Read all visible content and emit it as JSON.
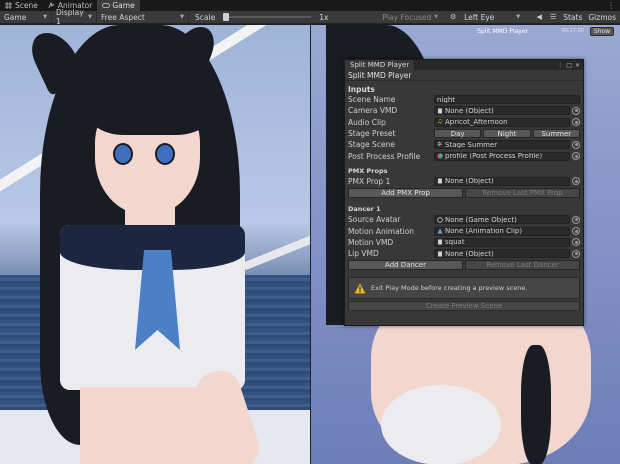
{
  "tabs": [
    {
      "label": "Scene",
      "icon": "hash-icon"
    },
    {
      "label": "Animator",
      "icon": "animator-icon"
    },
    {
      "label": "Game",
      "icon": "gamepad-icon"
    }
  ],
  "toolbar": {
    "display_mode": "Game",
    "display": "Display 1",
    "aspect": "Free Aspect",
    "scale_label": "Scale",
    "scale_value": "1x",
    "play_focused": "Play Focused",
    "eye": "Left Eye",
    "stats": "Stats",
    "gizmos": "Gizmos"
  },
  "viewport_right": {
    "title": "Split MMD Player",
    "subtitle": "00:17:00",
    "show_label": "Show"
  },
  "window": {
    "tab": "Split MMD Player",
    "header": "Split MMD Player",
    "inputs_label": "Inputs",
    "scene_name": {
      "label": "Scene Name",
      "value": "night"
    },
    "camera_vmd": {
      "label": "Camera VMD",
      "value": "None (Object)"
    },
    "audio_clip": {
      "label": "Audio Clip",
      "value": "Apricot_Afternoon"
    },
    "stage_preset": {
      "label": "Stage Preset",
      "options": [
        "Day",
        "Night",
        "Summer"
      ]
    },
    "stage_scene": {
      "label": "Stage Scene",
      "value": "Stage Summer"
    },
    "post_process": {
      "label": "Post Process Profile",
      "value": "profile (Post Process Profile)"
    },
    "pmx_section": "PMX Props",
    "pmx_prop1": {
      "label": "PMX Prop 1",
      "value": "None (Object)"
    },
    "add_pmx": "Add PMX Prop",
    "remove_pmx": "Remove Last PMX Prop",
    "dancer_section": "Dancer 1",
    "source_avatar": {
      "label": "Source Avatar",
      "value": "None (Game Object)"
    },
    "motion_animation": {
      "label": "Motion Animation",
      "value": "None (Animation Clip)"
    },
    "motion_vmd": {
      "label": "Motion VMD",
      "value": "squat"
    },
    "lip_vmd": {
      "label": "Lip VMD",
      "value": "None (Object)"
    },
    "add_dancer": "Add Dancer",
    "remove_dancer": "Remove Last Dancer",
    "help_text": "Exit Play Mode before creating a preview scene.",
    "create_preview": "Create Preview Scene"
  },
  "colors": {
    "accent_warning": "#e8b62a",
    "panel": "#383838",
    "field": "#2a2a2a"
  }
}
